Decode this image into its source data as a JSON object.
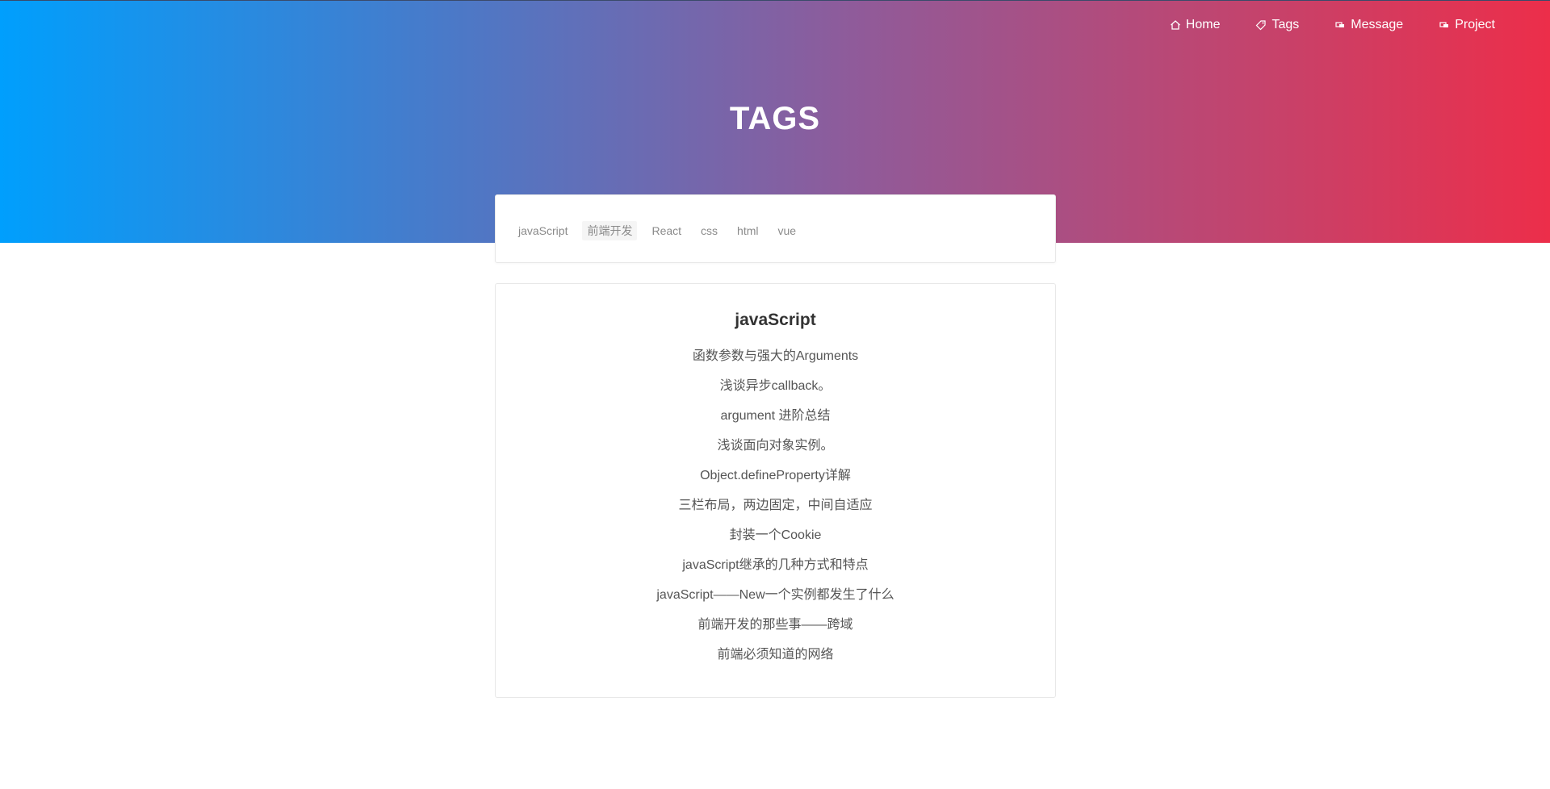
{
  "nav": {
    "items": [
      {
        "label": "Home",
        "icon": "home-icon"
      },
      {
        "label": "Tags",
        "icon": "tag-icon"
      },
      {
        "label": "Message",
        "icon": "message-icon"
      },
      {
        "label": "Project",
        "icon": "project-icon"
      }
    ]
  },
  "header": {
    "title": "TAGS",
    "gradient_start": "#009ffd",
    "gradient_end": "#ec2e4a"
  },
  "tags": {
    "items": [
      "javaScript",
      "前端开发",
      "React",
      "css",
      "html",
      "vue"
    ]
  },
  "section": {
    "title": "javaScript",
    "posts": [
      "函数参数与强大的Arguments",
      "浅谈异步callback。",
      "argument 进阶总结",
      "浅谈面向对象实例。",
      "Object.defineProperty详解",
      "三栏布局，两边固定，中间自适应",
      "封装一个Cookie",
      "javaScript继承的几种方式和特点",
      "javaScript——New一个实例都发生了什么",
      "前端开发的那些事——跨域",
      "前端必须知道的网络"
    ]
  }
}
